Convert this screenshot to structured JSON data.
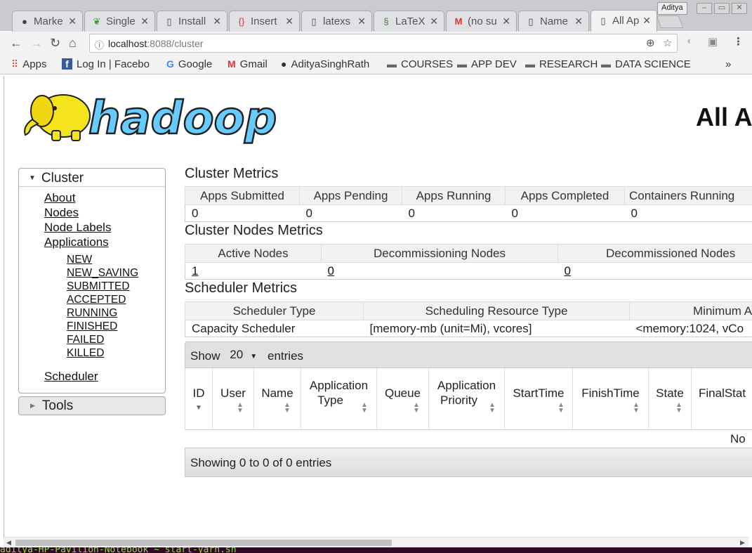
{
  "browser": {
    "tabs": [
      {
        "title": "Marke",
        "icon": "github-icon",
        "active": false
      },
      {
        "title": "Single",
        "icon": "leaf-icon",
        "active": false
      },
      {
        "title": "Install",
        "icon": "page-icon",
        "active": false
      },
      {
        "title": "Insert",
        "icon": "code-icon",
        "active": false
      },
      {
        "title": "latexs",
        "icon": "page-icon",
        "active": false
      },
      {
        "title": "LaTeX",
        "icon": "overleaf-icon",
        "active": false
      },
      {
        "title": "(no su",
        "icon": "gmail-icon",
        "active": false
      },
      {
        "title": "Name",
        "icon": "page-icon",
        "active": false
      },
      {
        "title": "All Ap",
        "icon": "page-icon",
        "active": true
      }
    ],
    "profile_name": "Aditya",
    "url_host": "localhost",
    "url_path": ":8088/cluster",
    "bookmarks": [
      {
        "label": "Apps",
        "icon": "apps-grid-icon"
      },
      {
        "label": "Log In | Facebo",
        "icon": "facebook-icon"
      },
      {
        "label": "Google",
        "icon": "google-icon"
      },
      {
        "label": "Gmail",
        "icon": "gmail-icon"
      },
      {
        "label": "AdityaSinghRath",
        "icon": "github-icon"
      },
      {
        "label": "COURSES",
        "icon": "folder-icon"
      },
      {
        "label": "APP DEV",
        "icon": "folder-icon"
      },
      {
        "label": "RESEARCH",
        "icon": "folder-icon"
      },
      {
        "label": "DATA SCIENCE",
        "icon": "folder-icon"
      }
    ],
    "bookmarks_overflow": "»"
  },
  "page": {
    "logo_text": "hadoop",
    "heading": "All A"
  },
  "sidebar": {
    "cluster_label": "Cluster",
    "links": [
      "About",
      "Nodes",
      "Node Labels",
      "Applications"
    ],
    "app_states": [
      "NEW",
      "NEW_SAVING",
      "SUBMITTED",
      "ACCEPTED",
      "RUNNING",
      "FINISHED",
      "FAILED",
      "KILLED"
    ],
    "scheduler_label": "Scheduler",
    "tools_label": "Tools"
  },
  "cluster_metrics": {
    "title": "Cluster Metrics",
    "headers": [
      "Apps Submitted",
      "Apps Pending",
      "Apps Running",
      "Apps Completed",
      "Containers Running"
    ],
    "values": [
      "0",
      "0",
      "0",
      "0",
      "0"
    ]
  },
  "node_metrics": {
    "title": "Cluster Nodes Metrics",
    "headers": [
      "Active Nodes",
      "Decommissioning Nodes",
      "Decommissioned Nodes"
    ],
    "values": [
      "1",
      "0",
      "0"
    ]
  },
  "scheduler_metrics": {
    "title": "Scheduler Metrics",
    "headers": [
      "Scheduler Type",
      "Scheduling Resource Type",
      "Minimum A"
    ],
    "values": [
      "Capacity Scheduler",
      "[memory-mb (unit=Mi), vcores]",
      "<memory:1024, vCo"
    ]
  },
  "apps_table": {
    "show_label": "Show",
    "page_length": "20",
    "entries_label": "entries",
    "columns": [
      {
        "line1": "ID",
        "line2": ""
      },
      {
        "line1": "User",
        "line2": ""
      },
      {
        "line1": "Name",
        "line2": ""
      },
      {
        "line1": "Application",
        "line2": "Type"
      },
      {
        "line1": "Queue",
        "line2": ""
      },
      {
        "line1": "Application",
        "line2": "Priority"
      },
      {
        "line1": "StartTime",
        "line2": ""
      },
      {
        "line1": "FinishTime",
        "line2": ""
      },
      {
        "line1": "State",
        "line2": ""
      },
      {
        "line1": "FinalStat",
        "line2": ""
      }
    ],
    "empty_text": "No",
    "footer_info": "Showing 0 to 0 of 0 entries"
  },
  "terminal_text": "aditya-HP-Pavilion-Notebook  ~ start-yarn.sh"
}
